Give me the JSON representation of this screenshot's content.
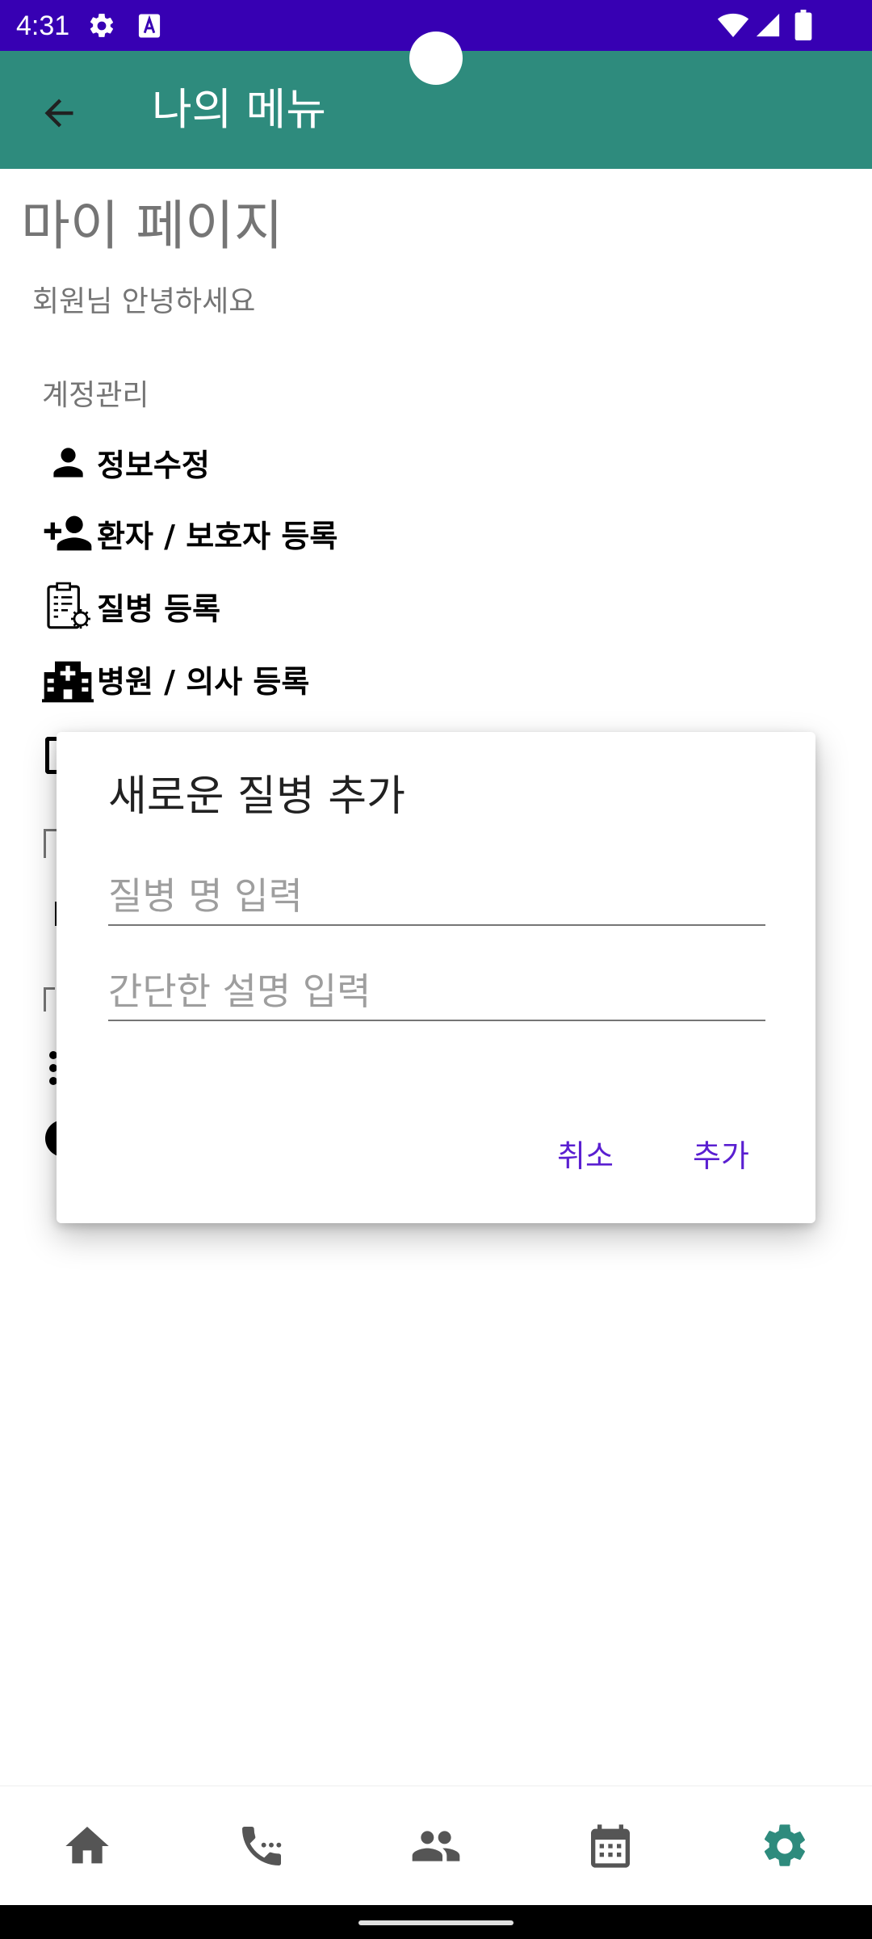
{
  "status_bar": {
    "time": "4:31",
    "icons": [
      "settings-icon",
      "a-icon",
      "wifi-icon",
      "signal-icon",
      "battery-icon"
    ],
    "background": "#3700b3"
  },
  "app_bar": {
    "title": "나의 메뉴",
    "back_icon": "arrow-back-icon",
    "background": "#2e8b7d"
  },
  "page": {
    "title": "마이 페이지",
    "greeting": "회원님 안녕하세요"
  },
  "account_section": {
    "label": "계정관리",
    "items": [
      {
        "label": "정보수정",
        "icon": "person-icon"
      },
      {
        "label": "환자 / 보호자 등록",
        "icon": "person-add-icon"
      },
      {
        "label": "질병 등록",
        "icon": "clipboard-virus-icon"
      },
      {
        "label": "병원 / 의사 등록",
        "icon": "hospital-icon"
      }
    ]
  },
  "dialog": {
    "title": "새로운 질병 추가",
    "name_placeholder": "질병 명 입력",
    "desc_placeholder": "간단한 설명 입력",
    "cancel_label": "취소",
    "add_label": "추가",
    "accent": "#5a1fd1"
  },
  "bottom_nav": {
    "items": [
      "home-icon",
      "phone-icon",
      "people-icon",
      "calendar-icon",
      "settings-icon"
    ],
    "active": "settings-icon",
    "active_color": "#2e8b7d",
    "inactive_color": "#555555"
  }
}
